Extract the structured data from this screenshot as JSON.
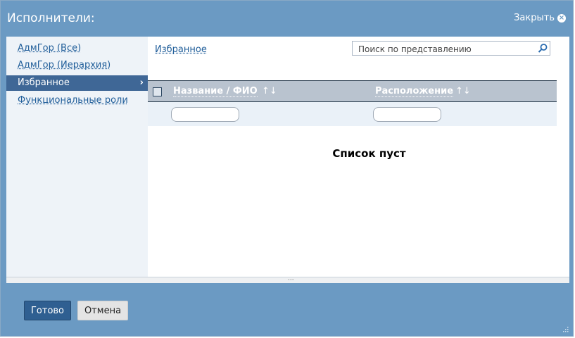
{
  "dialog": {
    "title": "Исполнители:",
    "close_label": "Закрыть"
  },
  "sidebar": {
    "items": [
      {
        "label": "АдмГор (Все)"
      },
      {
        "label": "АдмГор (Иерархия)"
      },
      {
        "label": "Избранное",
        "active": true,
        "chevron": "›"
      },
      {
        "label": "Функциональные роли"
      }
    ]
  },
  "main": {
    "breadcrumb": "Избранное",
    "search": {
      "placeholder": "Поиск по представлению",
      "value": ""
    },
    "table": {
      "columns": [
        {
          "label": "Название / ФИО",
          "sort_icon": "↑↓"
        },
        {
          "label": "Расположение",
          "sort_icon": "↑↓"
        }
      ],
      "filters": [
        "",
        ""
      ],
      "empty_text": "Список пуст"
    }
  },
  "footer": {
    "ok_label": "Готово",
    "cancel_label": "Отмена"
  },
  "splitter": {
    "grip": "···"
  }
}
